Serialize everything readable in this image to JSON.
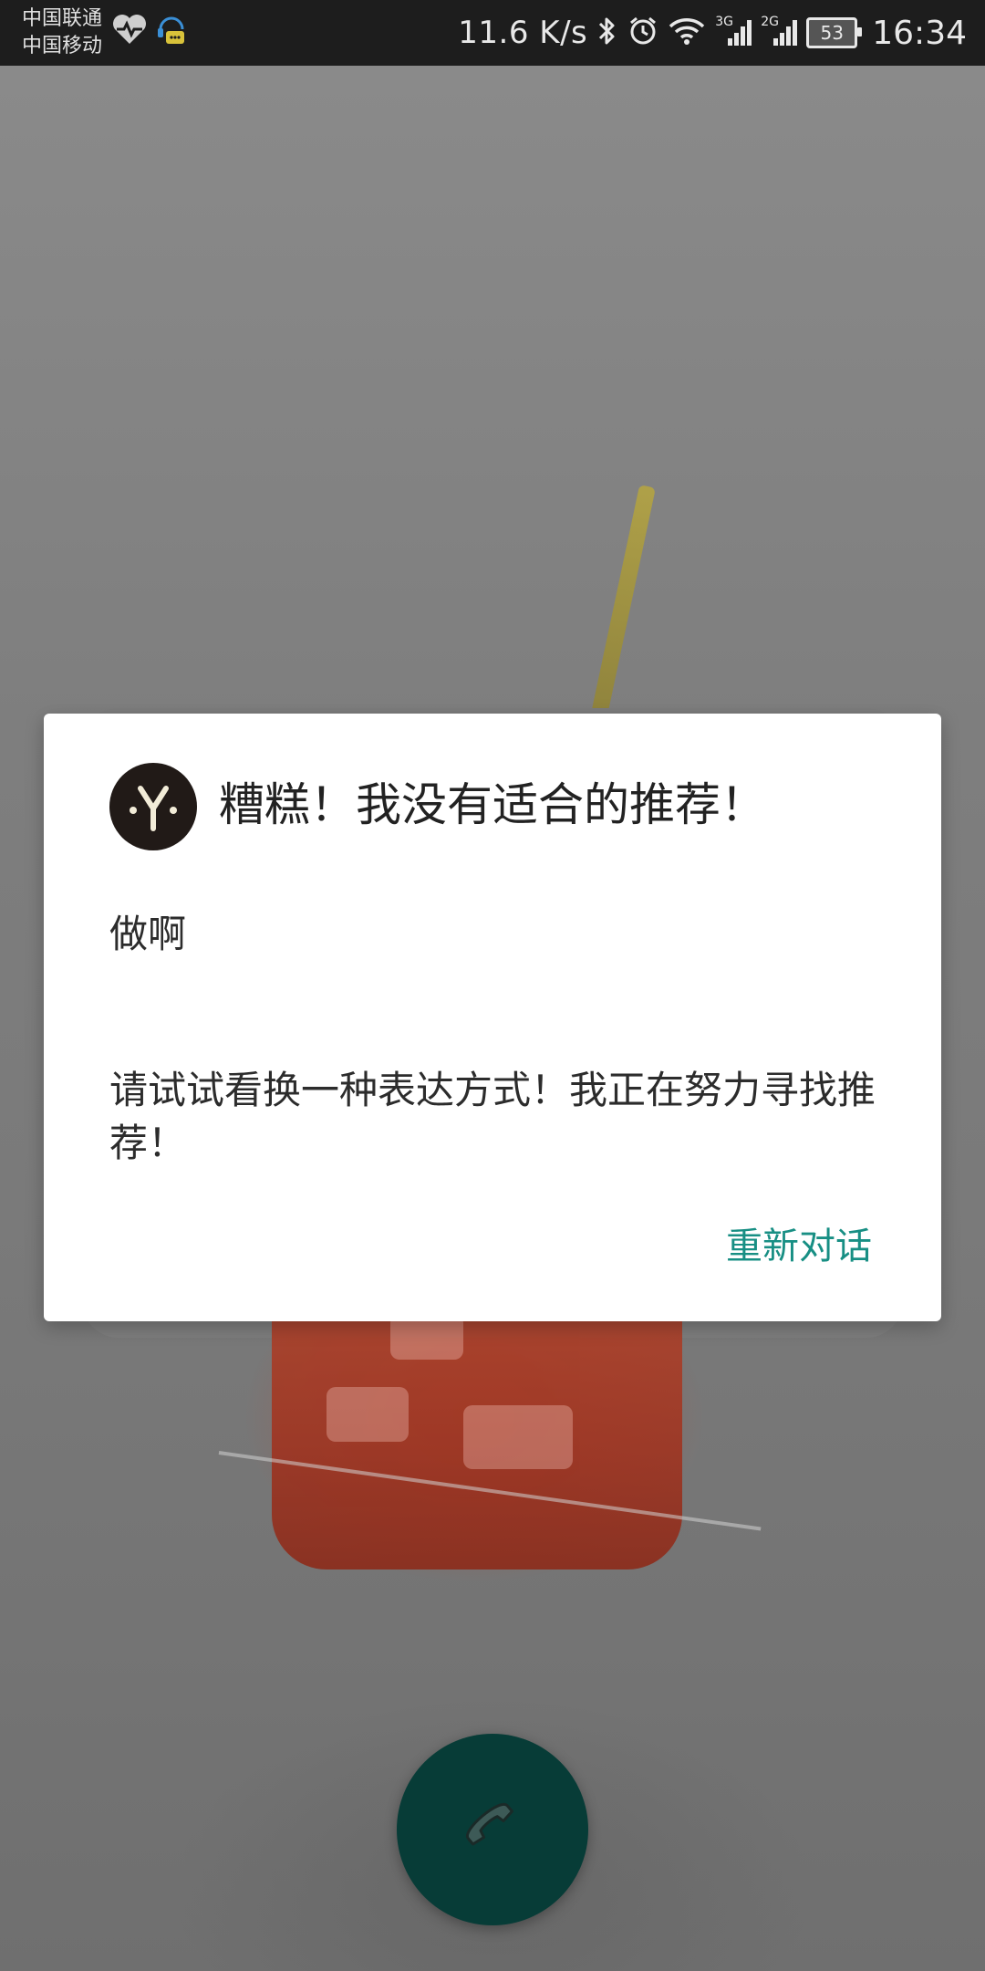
{
  "status_bar": {
    "carrier_1": "中国联通",
    "carrier_2": "中国移动",
    "net_speed": "11.6 K/s",
    "signal_3g": "3G",
    "signal_2g": "2G",
    "battery": "53",
    "time": "16:34",
    "icons": [
      "heart-rate-icon",
      "chat-bot-icon",
      "bluetooth-icon",
      "alarm-icon",
      "wifi-icon",
      "signal-icon"
    ]
  },
  "dialog": {
    "title": "糟糕！我没有适合的推荐！",
    "query": "做啊",
    "message": "请试试看换一种表达方式！我正在努力寻找推荐！",
    "action_label": "重新对话",
    "accent_color": "#188f84"
  },
  "fab": {
    "icon": "phone-icon",
    "color": "#073c37"
  }
}
